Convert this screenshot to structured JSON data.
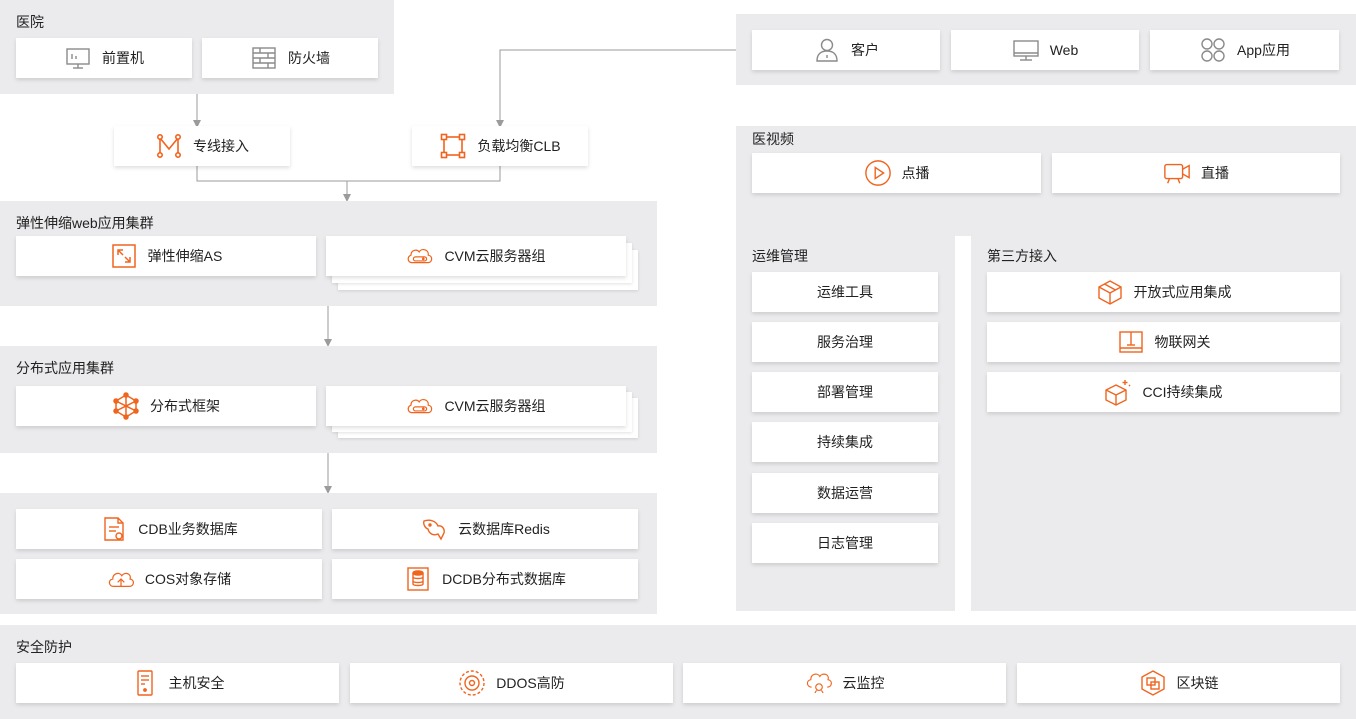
{
  "hospital": {
    "title": "医院",
    "front_machine": "前置机",
    "firewall": "防火墙"
  },
  "access": {
    "dedicated_line": "专线接入",
    "clb": "负载均衡CLB"
  },
  "elastic_cluster": {
    "title": "弹性伸缩web应用集群",
    "as": "弹性伸缩AS",
    "cvm_group": "CVM云服务器组"
  },
  "distributed_cluster": {
    "title": "分布式应用集群",
    "framework": "分布式框架",
    "cvm_group": "CVM云服务器组"
  },
  "databases": {
    "cdb": "CDB业务数据库",
    "redis": "云数据库Redis",
    "cos": "COS对象存储",
    "dcdb": "DCDB分布式数据库"
  },
  "clients": {
    "customer": "客户",
    "web": "Web",
    "app": "App应用"
  },
  "video": {
    "title": "医视频",
    "vod": "点播",
    "live": "直播"
  },
  "ops": {
    "title": "运维管理",
    "items": [
      "运维工具",
      "服务治理",
      "部署管理",
      "持续集成",
      "数据运营",
      "日志管理"
    ]
  },
  "third_party": {
    "title": "第三方接入",
    "open_integration": "开放式应用集成",
    "iot_gateway": "物联网关",
    "cci": "CCI持续集成"
  },
  "security": {
    "title": "安全防护",
    "host": "主机安全",
    "ddos": "DDOS高防",
    "monitor": "云监控",
    "blockchain": "区块链"
  },
  "colors": {
    "accent": "#f0641e",
    "icon_gray": "#8a8a8a",
    "panel": "#ebebed",
    "line": "#9b9b9b"
  }
}
